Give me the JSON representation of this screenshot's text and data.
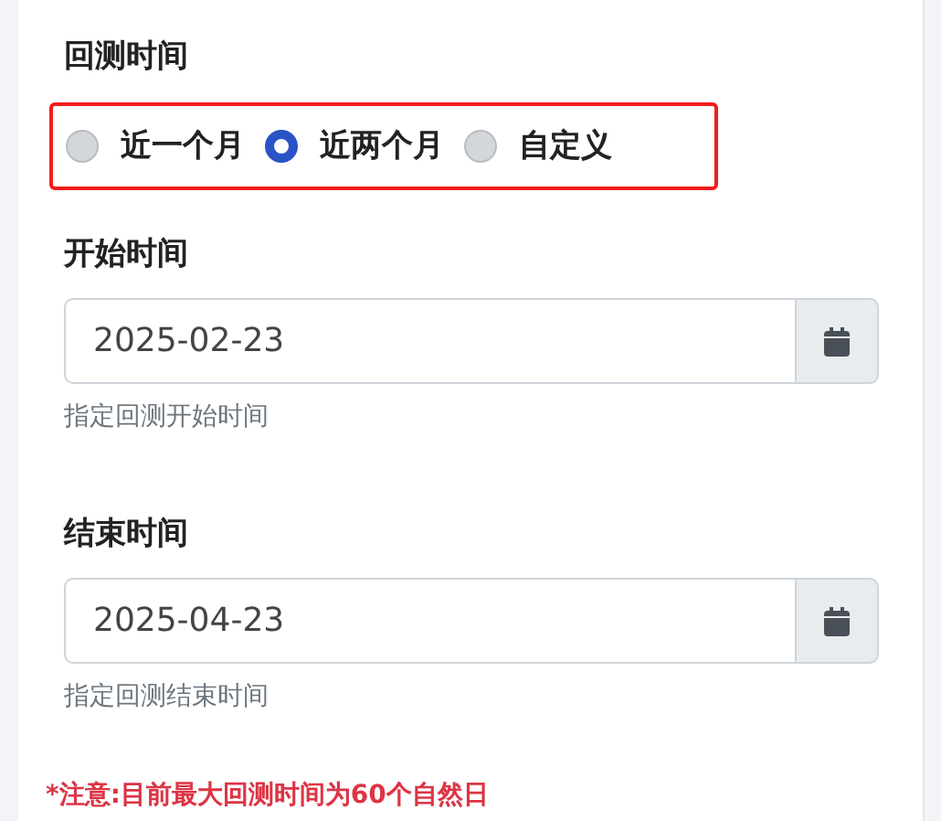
{
  "section_title": "回测时间",
  "range_options": [
    {
      "label": "近一个月",
      "selected": false
    },
    {
      "label": "近两个月",
      "selected": true
    },
    {
      "label": "自定义",
      "selected": false
    }
  ],
  "fields": [
    {
      "label": "开始时间",
      "value": "2025-02-23",
      "hint": "指定回测开始时间"
    },
    {
      "label": "结束时间",
      "value": "2025-04-23",
      "hint": "指定回测结束时间"
    }
  ],
  "note": "*注意:目前最大回测时间为60个自然日"
}
